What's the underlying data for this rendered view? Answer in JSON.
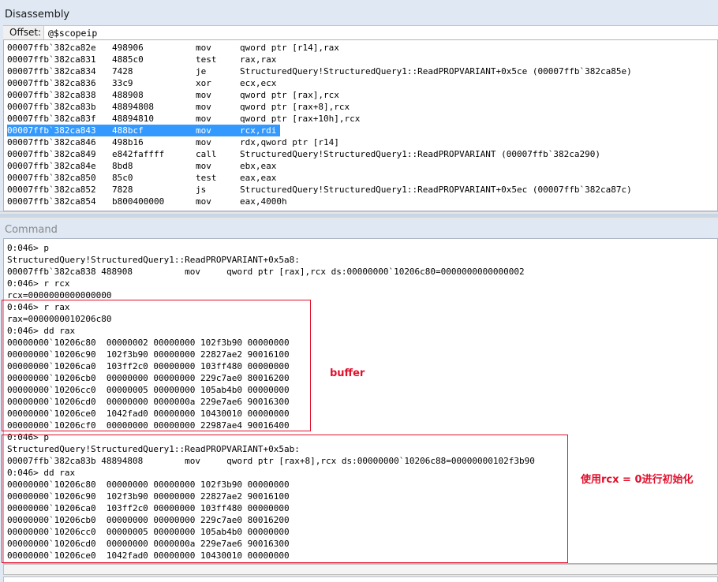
{
  "disassembly": {
    "title": "Disassembly",
    "offset_label": "Offset:",
    "offset_value": "@$scopeip",
    "rows": [
      {
        "addr": "00007ffb`382ca82e",
        "bytes": "498906",
        "mn": "mov",
        "op": "qword ptr [r14],rax"
      },
      {
        "addr": "00007ffb`382ca831",
        "bytes": "4885c0",
        "mn": "test",
        "op": "rax,rax"
      },
      {
        "addr": "00007ffb`382ca834",
        "bytes": "7428",
        "mn": "je",
        "op": "StructuredQuery!StructuredQuery1::ReadPROPVARIANT+0x5ce (00007ffb`382ca85e)"
      },
      {
        "addr": "00007ffb`382ca836",
        "bytes": "33c9",
        "mn": "xor",
        "op": "ecx,ecx"
      },
      {
        "addr": "00007ffb`382ca838",
        "bytes": "488908",
        "mn": "mov",
        "op": "qword ptr [rax],rcx"
      },
      {
        "addr": "00007ffb`382ca83b",
        "bytes": "48894808",
        "mn": "mov",
        "op": "qword ptr [rax+8],rcx"
      },
      {
        "addr": "00007ffb`382ca83f",
        "bytes": "48894810",
        "mn": "mov",
        "op": "qword ptr [rax+10h],rcx"
      },
      {
        "addr": "00007ffb`382ca843",
        "bytes": "488bcf",
        "mn": "mov",
        "op": "rcx,rdi",
        "selected": true
      },
      {
        "addr": "00007ffb`382ca846",
        "bytes": "498b16",
        "mn": "mov",
        "op": "rdx,qword ptr [r14]"
      },
      {
        "addr": "00007ffb`382ca849",
        "bytes": "e842faffff",
        "mn": "call",
        "op": "StructuredQuery!StructuredQuery1::ReadPROPVARIANT (00007ffb`382ca290)"
      },
      {
        "addr": "00007ffb`382ca84e",
        "bytes": "8bd8",
        "mn": "mov",
        "op": "ebx,eax"
      },
      {
        "addr": "00007ffb`382ca850",
        "bytes": "85c0",
        "mn": "test",
        "op": "eax,eax"
      },
      {
        "addr": "00007ffb`382ca852",
        "bytes": "7828",
        "mn": "js",
        "op": "StructuredQuery!StructuredQuery1::ReadPROPVARIANT+0x5ec (00007ffb`382ca87c)"
      },
      {
        "addr": "00007ffb`382ca854",
        "bytes": "b800400000",
        "mn": "mov",
        "op": "eax,4000h"
      }
    ]
  },
  "command": {
    "title": "Command",
    "lines": [
      "0:046> p",
      "StructuredQuery!StructuredQuery1::ReadPROPVARIANT+0x5a8:",
      "00007ffb`382ca838 488908          mov     qword ptr [rax],rcx ds:00000000`10206c80=0000000000000002",
      "0:046> r rcx",
      "rcx=0000000000000000",
      "0:046> r rax",
      "rax=0000000010206c80",
      "0:046> dd rax",
      "00000000`10206c80  00000002 00000000 102f3b90 00000000",
      "00000000`10206c90  102f3b90 00000000 22827ae2 90016100",
      "00000000`10206ca0  103ff2c0 00000000 103ff480 00000000",
      "00000000`10206cb0  00000000 00000000 229c7ae0 80016200",
      "00000000`10206cc0  00000005 00000000 105ab4b0 00000000",
      "00000000`10206cd0  00000000 0000000a 229e7ae6 90016300",
      "00000000`10206ce0  1042fad0 00000000 10430010 00000000",
      "00000000`10206cf0  00000000 00000000 22987ae4 90016400",
      "0:046> p",
      "StructuredQuery!StructuredQuery1::ReadPROPVARIANT+0x5ab:",
      "00007ffb`382ca83b 48894808        mov     qword ptr [rax+8],rcx ds:00000000`10206c88=00000000102f3b90",
      "0:046> dd rax",
      "00000000`10206c80  00000000 00000000 102f3b90 00000000",
      "00000000`10206c90  102f3b90 00000000 22827ae2 90016100",
      "00000000`10206ca0  103ff2c0 00000000 103ff480 00000000",
      "00000000`10206cb0  00000000 00000000 229c7ae0 80016200",
      "00000000`10206cc0  00000005 00000000 105ab4b0 00000000",
      "00000000`10206cd0  00000000 0000000a 229e7ae6 90016300",
      "00000000`10206ce0  1042fad0 00000000 10430010 00000000"
    ]
  },
  "annotations": {
    "buffer": "buffer",
    "init": "使用rcx = 0进行初始化"
  },
  "colors": {
    "selection": "#3399ff",
    "annotation": "#e0102c"
  }
}
